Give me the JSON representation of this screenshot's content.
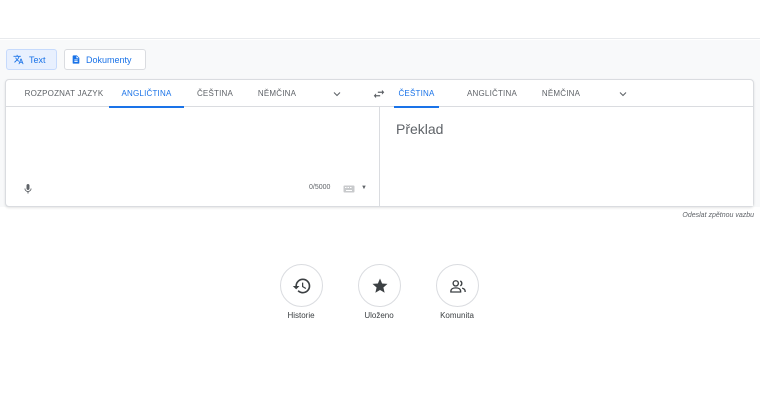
{
  "modes": {
    "text": "Text",
    "documents": "Dokumenty"
  },
  "source_languages": [
    "ROZPOZNAT JAZYK",
    "ANGLIČTINA",
    "ČEŠTINA",
    "NĚMČINA"
  ],
  "source_selected": "ANGLIČTINA",
  "target_languages": [
    "ČEŠTINA",
    "ANGLIČTINA",
    "NĚMČINA"
  ],
  "target_selected": "ČEŠTINA",
  "target": {
    "placeholder": "Překlad"
  },
  "source": {
    "char_count": "0/5000"
  },
  "feedback_link": "Odeslat zpětnou vazbu",
  "shortcuts": {
    "history": "Historie",
    "saved": "Uloženo",
    "community": "Komunita"
  },
  "colors": {
    "accent": "#1a73e8",
    "text": "#3c4043",
    "muted": "#5f6368",
    "border": "#dadce0"
  },
  "icons": [
    "translate-icon",
    "document-icon",
    "chevron-down-icon",
    "swap-icon",
    "microphone-icon",
    "keyboard-icon",
    "history-icon",
    "star-icon",
    "people-icon"
  ]
}
